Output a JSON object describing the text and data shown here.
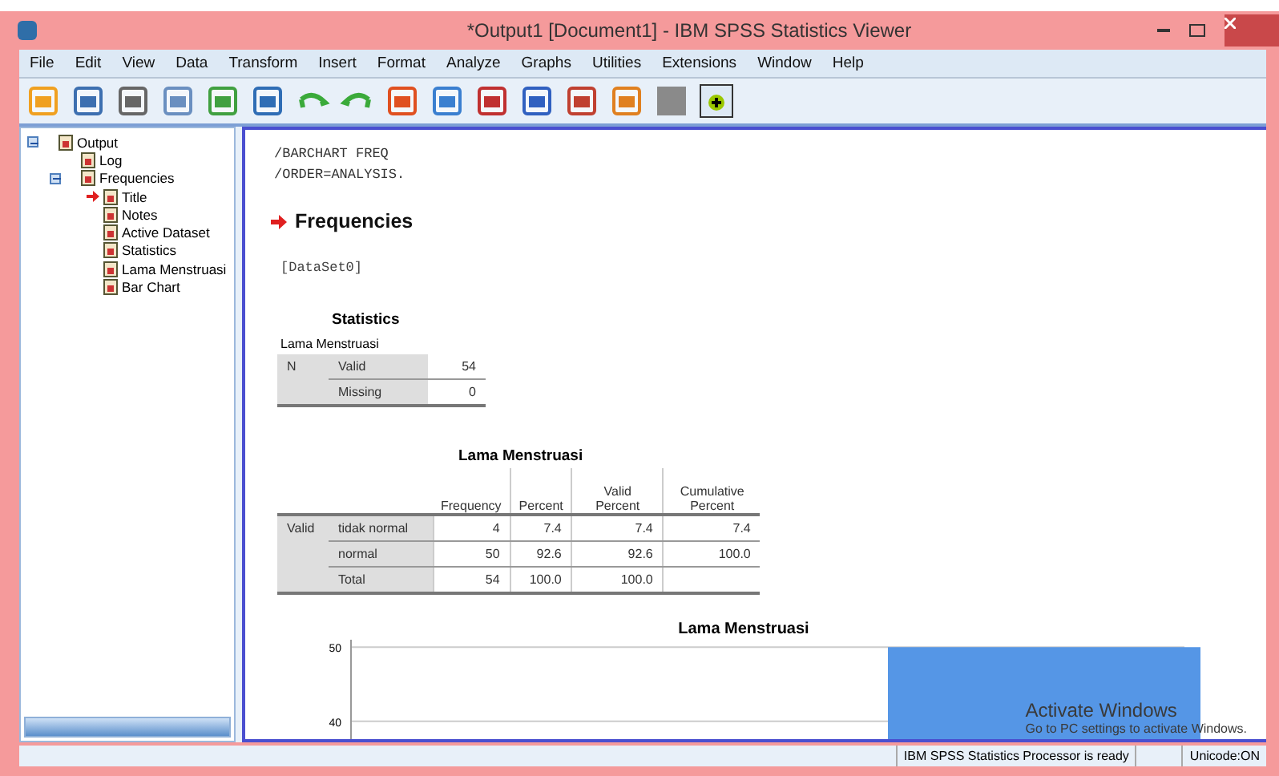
{
  "window": {
    "title": "*Output1 [Document1] - IBM SPSS Statistics Viewer"
  },
  "menu": [
    "File",
    "Edit",
    "View",
    "Data",
    "Transform",
    "Insert",
    "Format",
    "Analyze",
    "Graphs",
    "Utilities",
    "Extensions",
    "Window",
    "Help"
  ],
  "outline": [
    {
      "label": "Output",
      "expanded": true,
      "current": false,
      "children": [
        {
          "label": "Log",
          "current": false
        },
        {
          "label": "Frequencies",
          "expanded": true,
          "current": false,
          "children": [
            {
              "label": "Title",
              "current": true
            },
            {
              "label": "Notes",
              "current": false
            },
            {
              "label": "Active Dataset",
              "current": false
            },
            {
              "label": "Statistics",
              "current": false
            },
            {
              "label": "Lama Menstruasi",
              "current": false
            },
            {
              "label": "Bar Chart",
              "current": false
            }
          ]
        }
      ]
    }
  ],
  "viewer": {
    "syntax": [
      "/BARCHART FREQ",
      "/ORDER=ANALYSIS."
    ],
    "heading": "Frequencies",
    "dataset": "[DataSet0]",
    "statistics": {
      "title": "Statistics",
      "subtitle": "Lama Menstruasi",
      "rows": [
        [
          "N",
          "Valid",
          "54"
        ],
        [
          "",
          "Missing",
          "0"
        ]
      ]
    },
    "frequency_table": {
      "title": "Lama Menstruasi",
      "columns": [
        "",
        "",
        "Frequency",
        "Percent",
        "Valid Percent",
        "Cumulative Percent"
      ],
      "rows": [
        [
          "Valid",
          "tidak normal",
          "4",
          "7.4",
          "7.4",
          "7.4"
        ],
        [
          "",
          "normal",
          "50",
          "92.6",
          "92.6",
          "100.0"
        ],
        [
          "",
          "Total",
          "54",
          "100.0",
          "100.0",
          ""
        ]
      ]
    },
    "chart": {
      "chart_data": {
        "type": "bar",
        "title": "Lama Menstruasi",
        "values": [
          null,
          50
        ],
        "yticks": [
          40,
          50
        ],
        "ylim": [
          35,
          51
        ]
      }
    }
  },
  "os_overlay": [
    "Activate Windows",
    "Go to PC settings to activate Windows."
  ],
  "status_bar": {
    "message": "IBM SPSS Statistics Processor is ready",
    "unicode": "Unicode:ON"
  }
}
